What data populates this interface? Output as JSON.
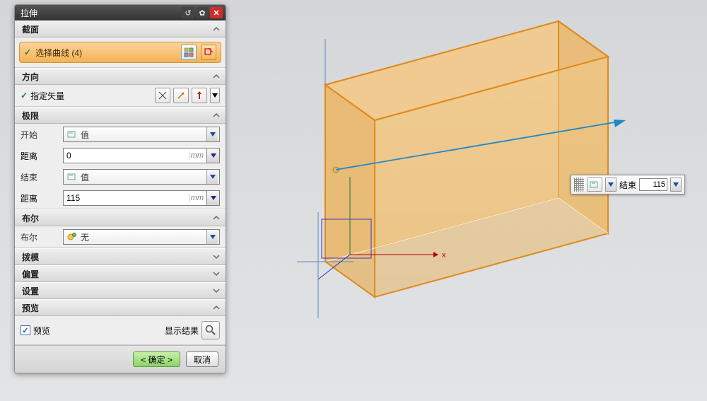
{
  "dialog": {
    "title": "拉伸",
    "sections": {
      "curve": {
        "header": "截面",
        "select_label": "选择曲线 (4)"
      },
      "direction": {
        "header": "方向",
        "vector_label": "指定矢量"
      },
      "limits": {
        "header": "极限",
        "start_label": "开始",
        "start_type": "值",
        "start_dist_label": "距离",
        "start_dist_value": "0",
        "end_label": "结束",
        "end_type": "值",
        "end_dist_label": "距离",
        "end_dist_value": "115",
        "unit": "mm"
      },
      "boolean": {
        "header": "布尔",
        "label": "布尔",
        "value": "无"
      },
      "draft": {
        "header": "拨模"
      },
      "offset": {
        "header": "偏置"
      },
      "settings": {
        "header": "设置"
      },
      "preview": {
        "header": "预览",
        "checkbox_label": "预览",
        "show_result_label": "显示结果"
      }
    },
    "footer": {
      "ok": "< 确定 >",
      "cancel": "取消"
    }
  },
  "viewport": {
    "end_chip_label": "结束",
    "end_chip_value": "115",
    "axis_x": "x"
  },
  "icons": {
    "up": "▲",
    "down": "▼"
  }
}
